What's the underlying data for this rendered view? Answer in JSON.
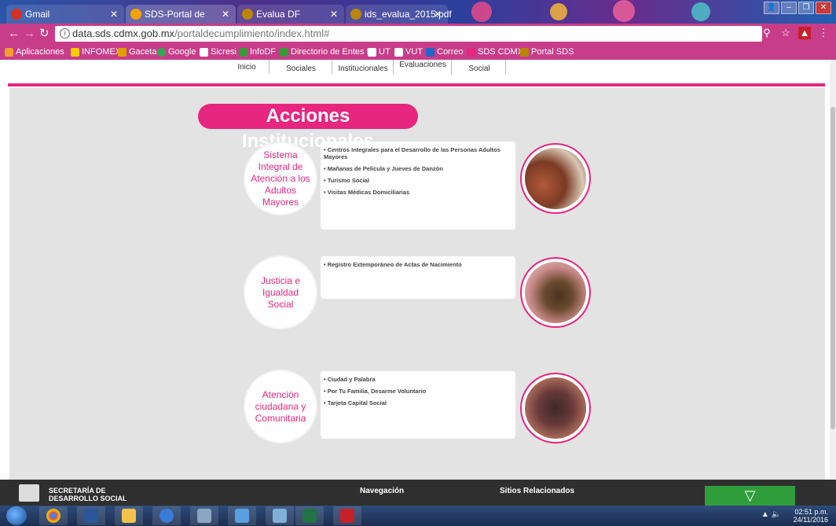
{
  "tabs": [
    {
      "label": "Gmail",
      "favicon_color": "#d93025"
    },
    {
      "label": "SDS-Portal de Cumplimi",
      "favicon_color": "#f4a300"
    },
    {
      "label": "Evalua DF",
      "favicon_color": "#b8860b"
    },
    {
      "label": "ids_evalua_2015.pdf",
      "favicon_color": "#b8860b"
    }
  ],
  "address": {
    "url_host": "data.sds.cdmx.gob.mx",
    "url_path": "/portaldecumplimiento/index.html#"
  },
  "bookmarks": [
    {
      "label": "Aplicaciones",
      "color": "#f0a030"
    },
    {
      "label": "INFOMEX",
      "color": "#ffcc00"
    },
    {
      "label": "Gaceta",
      "color": "#e2a000"
    },
    {
      "label": "Google",
      "color": "#34a853"
    },
    {
      "label": "Sicresi",
      "color": "#ffffff"
    },
    {
      "label": "InfoDF",
      "color": "#3a9a3a"
    },
    {
      "label": "Directorio de Entes P",
      "color": "#3a9a3a"
    },
    {
      "label": "UT",
      "color": "#ffffff"
    },
    {
      "label": "VUT",
      "color": "#ffffff"
    },
    {
      "label": "Correo",
      "color": "#2266cc"
    },
    {
      "label": "SDS CDMX",
      "color": "#e6267f"
    },
    {
      "label": "Portal SDS",
      "color": "#b8860b"
    }
  ],
  "topnav": {
    "inicio": "Inicio",
    "programas": "Sociales",
    "acciones": "Institucionales",
    "evaluaciones": "Evaluaciones",
    "comunicacion": "Social"
  },
  "heading": "Acciones Institucionales",
  "sections": [
    {
      "title": "Sistema Integral de Atención a los Adultos Mayores",
      "items": [
        "• Centros Integrales para el Desarrollo de las Personas Adultos Mayores",
        "• Mañanas de Película y Jueves de Danzón",
        "• Turismo Social",
        "• Visitas Médicas Domiciliarias"
      ]
    },
    {
      "title": "Justicia e Igualdad Social",
      "items": [
        "• Registro Extemporáneo de Actas de Nacimiento"
      ]
    },
    {
      "title": "Atención ciudadana y Comunitaria",
      "items": [
        "• Ciudad y Palabra",
        "• Por Tu Familia, Desarme Voluntario",
        "• Tarjeta Capital Social"
      ]
    }
  ],
  "footer": {
    "org_line1": "SECRETARÍA DE",
    "org_line2": "DESARROLLO SOCIAL",
    "nav": "Navegación",
    "related": "Sitios Relacionados"
  },
  "clock": {
    "time": "02:51 p.m.",
    "date": "24/11/2016"
  },
  "colors": {
    "accent": "#e6267f",
    "browser": "#c83d8a",
    "content_bg": "#e3e3e3"
  }
}
